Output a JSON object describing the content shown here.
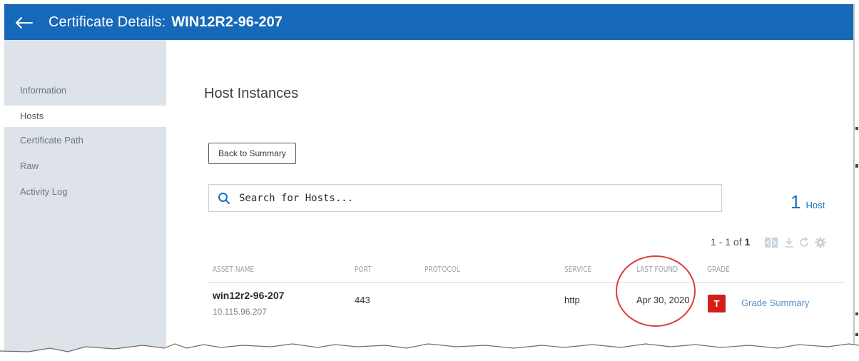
{
  "header": {
    "title": "Certificate Details:",
    "certificate_name": "WIN12R2-96-207",
    "back_icon": "arrow-left-icon"
  },
  "sidebar": {
    "items": [
      {
        "label": "Information",
        "active": false
      },
      {
        "label": "Hosts",
        "active": true
      },
      {
        "label": "Certificate Path",
        "active": false
      },
      {
        "label": "Raw",
        "active": false
      },
      {
        "label": "Activity Log",
        "active": false
      }
    ]
  },
  "main": {
    "section_title": "Host Instances",
    "back_button_label": "Back to Summary",
    "search": {
      "placeholder": "Search for Hosts...",
      "value": "",
      "icon": "search-icon"
    },
    "host_count": {
      "number": "1",
      "label": "Host"
    },
    "pagination": {
      "range": "1 - 1 of",
      "total": "1"
    },
    "toolbar_icons": [
      "expand-columns-icon",
      "download-icon",
      "refresh-icon",
      "gear-icon"
    ],
    "table": {
      "columns": [
        "ASSET NAME",
        "PORT",
        "PROTOCOL",
        "SERVICE",
        "LAST FOUND",
        "GRADE"
      ],
      "rows": [
        {
          "asset_name": "win12r2-96-207",
          "asset_ip": "10.115.96.207",
          "port": "443",
          "protocol": "",
          "service": "http",
          "last_found": "Apr 30, 2020",
          "grade": "T",
          "grade_link": "Grade Summary"
        }
      ]
    }
  },
  "colors": {
    "header_bg": "#1668b8",
    "sidebar_bg": "#dde3e8",
    "accent_blue": "#1a6fc3",
    "grade_badge": "#d32016",
    "annotation_circle": "#dd3c3c"
  }
}
